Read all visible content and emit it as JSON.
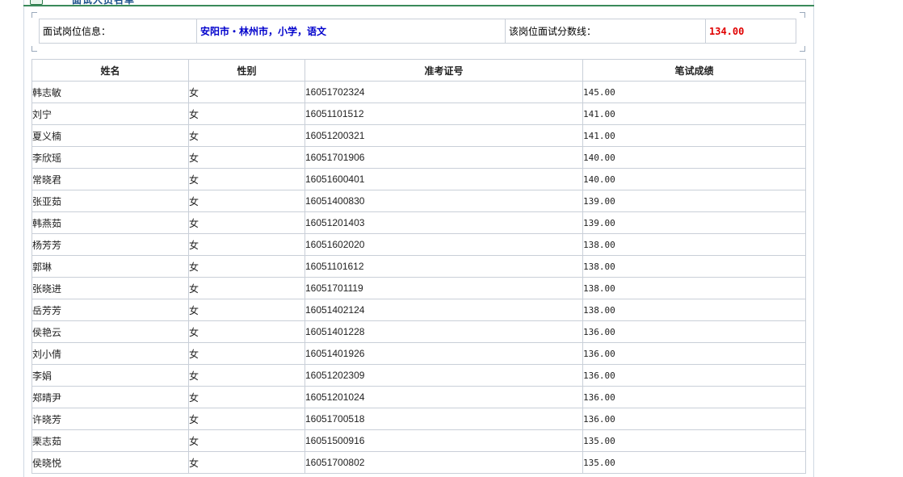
{
  "header": {
    "title": "面试人员名单"
  },
  "info": {
    "position_label": "面试岗位信息：",
    "position_value": "安阳市・林州市，小学，语文",
    "cutoff_label": "该岗位面试分数线：",
    "cutoff_value": "134.00"
  },
  "table": {
    "columns": [
      "姓名",
      "性别",
      "准考证号",
      "笔试成绩"
    ],
    "rows": [
      [
        "韩志敏",
        "女",
        "16051702324",
        "145.00"
      ],
      [
        "刘宁",
        "女",
        "16051101512",
        "141.00"
      ],
      [
        "夏义楠",
        "女",
        "16051200321",
        "141.00"
      ],
      [
        "李欣瑶",
        "女",
        "16051701906",
        "140.00"
      ],
      [
        "常晓君",
        "女",
        "16051600401",
        "140.00"
      ],
      [
        "张亚茹",
        "女",
        "16051400830",
        "139.00"
      ],
      [
        "韩燕茹",
        "女",
        "16051201403",
        "139.00"
      ],
      [
        "杨芳芳",
        "女",
        "16051602020",
        "138.00"
      ],
      [
        "郭琳",
        "女",
        "16051101612",
        "138.00"
      ],
      [
        "张晓进",
        "女",
        "16051701119",
        "138.00"
      ],
      [
        "岳芳芳",
        "女",
        "16051402124",
        "138.00"
      ],
      [
        "侯艳云",
        "女",
        "16051401228",
        "136.00"
      ],
      [
        "刘小倩",
        "女",
        "16051401926",
        "136.00"
      ],
      [
        "李娟",
        "女",
        "16051202309",
        "136.00"
      ],
      [
        "郑晴尹",
        "女",
        "16051201024",
        "136.00"
      ],
      [
        "许晓芳",
        "女",
        "16051700518",
        "136.00"
      ],
      [
        "栗志茹",
        "女",
        "16051500916",
        "135.00"
      ],
      [
        "侯晓悦",
        "女",
        "16051700802",
        "135.00"
      ]
    ]
  }
}
